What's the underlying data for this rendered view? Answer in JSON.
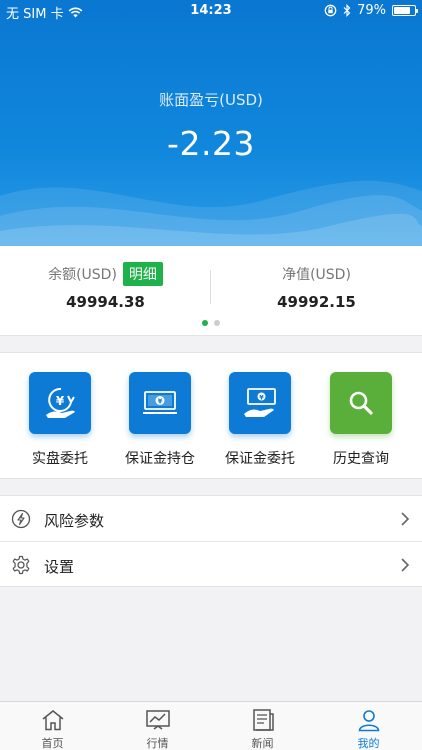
{
  "status_bar": {
    "carrier": "无 SIM 卡",
    "time": "14:23",
    "battery": "79%",
    "battery_level": 0.79
  },
  "header": {
    "pnl_label": "账面盈亏(USD)",
    "pnl_value": "-2.23"
  },
  "balance": {
    "balance_label": "余额(USD)",
    "detail_button": "明细",
    "balance_value": "49994.38",
    "equity_label": "净值(USD)",
    "equity_value": "49992.15",
    "pages": 2,
    "current_page": 1
  },
  "actions": [
    {
      "label": "实盘委托",
      "icon": "yuan-hand-icon",
      "color": "#0d7bd6"
    },
    {
      "label": "保证金持仓",
      "icon": "banknote-icon",
      "color": "#0d7bd6"
    },
    {
      "label": "保证金委托",
      "icon": "banknote-hand-icon",
      "color": "#0d7bd6"
    },
    {
      "label": "历史查询",
      "icon": "search-icon",
      "color": "#5aae3a"
    }
  ],
  "menu": [
    {
      "label": "风险参数",
      "icon": "lightning-circle-icon"
    },
    {
      "label": "设置",
      "icon": "gear-icon"
    }
  ],
  "tabs": [
    {
      "label": "首页",
      "icon": "home-icon",
      "active": false
    },
    {
      "label": "行情",
      "icon": "chart-icon",
      "active": false
    },
    {
      "label": "新闻",
      "icon": "news-icon",
      "active": false
    },
    {
      "label": "我的",
      "icon": "person-icon",
      "active": true
    }
  ],
  "colors": {
    "primary": "#0d7bd6",
    "accent_green": "#1fb14a",
    "search_green": "#5aae3a"
  }
}
